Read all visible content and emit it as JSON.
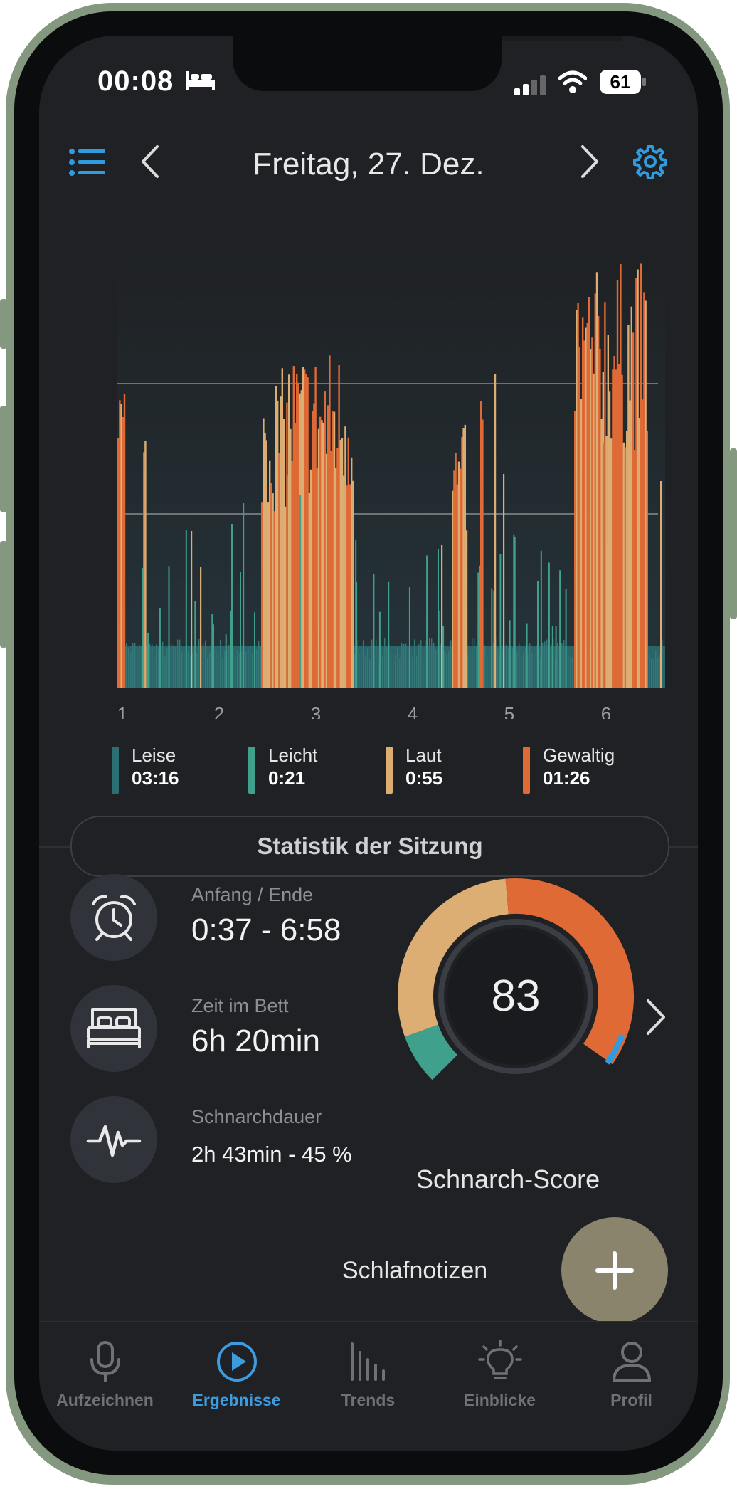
{
  "status_bar": {
    "time": "00:08",
    "battery": "61"
  },
  "header": {
    "title": "Freitag, 27. Dez."
  },
  "colors": {
    "leise": "#2c6f73",
    "leicht": "#3fa08c",
    "laut": "#dcae73",
    "gewaltig": "#e06a36",
    "accent_blue": "#2f9be0",
    "fab": "#8a846d"
  },
  "chart_data": {
    "type": "area",
    "x_ticks": [
      "1",
      "2",
      "3",
      "4",
      "5",
      "6"
    ],
    "series": [
      {
        "name": "Leise"
      },
      {
        "name": "Leicht"
      },
      {
        "name": "Laut"
      },
      {
        "name": "Gewaltig"
      }
    ],
    "gridlines": 3
  },
  "legend": [
    {
      "name": "Leise",
      "value": "03:16"
    },
    {
      "name": "Leicht",
      "value": "0:21"
    },
    {
      "name": "Laut",
      "value": "0:55"
    },
    {
      "name": "Gewaltig",
      "value": "01:26"
    }
  ],
  "session": {
    "title": "Statistik der Sitzung"
  },
  "stats": {
    "start_end": {
      "label": "Anfang / Ende",
      "value": "0:37 - 6:58"
    },
    "bed_time": {
      "label": "Zeit im Bett",
      "value": "6h 20min"
    },
    "snore_duration": {
      "label": "Schnarchdauer",
      "value": "2h 43min - 45 %"
    }
  },
  "score": {
    "value": "83",
    "label": "Schnarch-Score"
  },
  "notes": {
    "label": "Schlafnotizen"
  },
  "tabs": [
    {
      "label": "Aufzeichnen",
      "icon": "microphone-icon"
    },
    {
      "label": "Ergebnisse",
      "icon": "play-icon"
    },
    {
      "label": "Trends",
      "icon": "bars-icon"
    },
    {
      "label": "Einblicke",
      "icon": "lightbulb-icon"
    },
    {
      "label": "Profil",
      "icon": "person-icon"
    }
  ]
}
